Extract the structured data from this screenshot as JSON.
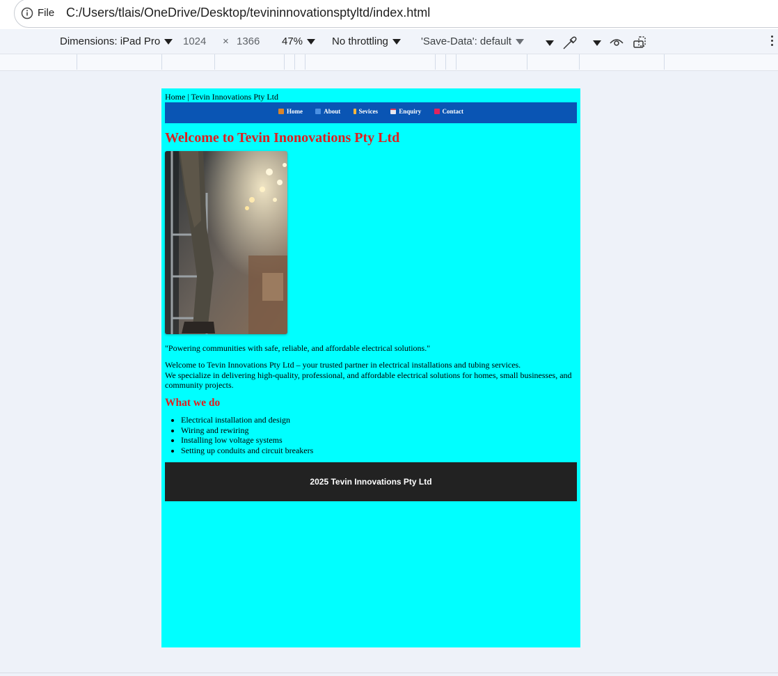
{
  "browser": {
    "file_label": "File",
    "url": "C:/Users/tlais/OneDrive/Desktop/tevininnovationsptyltd/index.html"
  },
  "devtools": {
    "dimensions_label": "Dimensions: iPad Pro",
    "width": "1024",
    "times": "×",
    "height": "1366",
    "zoom": "47%",
    "throttling": "No throttling",
    "save_data": "'Save-Data': default"
  },
  "page": {
    "breadcrumb": "Home | Tevin Innovations Pty Ltd",
    "nav": [
      {
        "label": "Home",
        "icon_color": "#d9852b"
      },
      {
        "label": "About",
        "icon_color": "#4a90e2"
      },
      {
        "label": "Sevices",
        "icon_color": "#f6b73c"
      },
      {
        "label": "Enquiry",
        "icon_color": "#e8e8f0"
      },
      {
        "label": "Contact",
        "icon_color": "#e0245e"
      }
    ],
    "heading": "Welcome to Tevin Inonovations Pty Ltd",
    "quote": "\"Powering communities with safe, reliable, and affordable electrical solutions.\"",
    "intro_line1": "Welcome to Tevin Innovations Pty Ltd – your trusted partner in electrical installations and tubing services.",
    "intro_line2": "We specialize in delivering high-quality, professional, and affordable electrical solutions for homes, small businesses, and community projects.",
    "what_we_do_heading": "What we do",
    "services": [
      "Electrical installation and design",
      "Wiring and rewiring",
      "Installing low voltage systems",
      "Setting up conduits and circuit breakers"
    ],
    "footer": "2025 Tevin Innovations Pty Ltd"
  },
  "colors": {
    "page_bg": "#00ffff",
    "nav_bg": "#0a55b4",
    "heading": "#e01e1e",
    "footer_bg": "#222222"
  }
}
